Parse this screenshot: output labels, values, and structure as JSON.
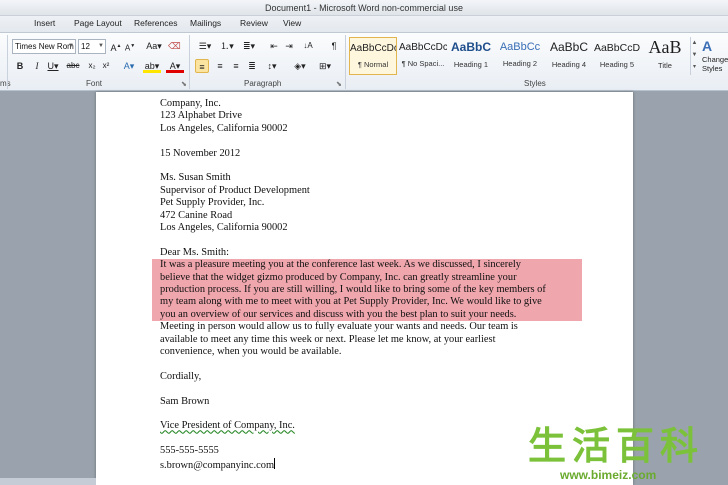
{
  "window": {
    "title": "Document1 - Microsoft Word non-commercial use"
  },
  "menu_tabs": [
    "Insert",
    "Page Layout",
    "References",
    "Mailings",
    "Review",
    "View"
  ],
  "ribbon": {
    "font_name": "Times New Rom",
    "font_size": "12",
    "groups": {
      "font": "Font",
      "paragraph": "Paragraph",
      "styles": "Styles"
    },
    "styles": [
      {
        "preview": "AaBbCcDc",
        "name": "¶ Normal"
      },
      {
        "preview": "AaBbCcDc",
        "name": "¶ No Spaci..."
      },
      {
        "preview": "AaBbC",
        "name": "Heading 1"
      },
      {
        "preview": "AaBbCc",
        "name": "Heading 2"
      },
      {
        "preview": "AaBbC",
        "name": "Heading 4"
      },
      {
        "preview": "AaBbCcD",
        "name": "Heading 5"
      },
      {
        "preview": "AaB",
        "name": "Title"
      }
    ],
    "change_styles": "Change Styles",
    "left_cut": "ms"
  },
  "document": {
    "lines_top": [
      "Company, Inc.",
      "123 Alphabet Drive",
      "Los Angeles, California 90002",
      "",
      "15 November 2012",
      "",
      "Ms. Susan Smith",
      "Supervisor of Product Development",
      "Pet Supply Provider, Inc.",
      "472 Canine Road",
      "Los Angeles, California 90002",
      "",
      "Dear Ms. Smith:"
    ],
    "highlighted": [
      "It was a pleasure meeting you at the conference last week. As we discussed, I sincerely",
      "believe that the widget gizmo produced by Company, Inc. can greatly streamline your",
      "production process. If you are still willing, I would like to bring some of the key members of",
      "my team along with me to meet with you at Pet Supply Provider, Inc. We would like to give",
      "you an overview of our services and discuss with you the best plan to suit your needs."
    ],
    "lines_bottom": [
      "Meeting in person would allow us to fully evaluate your wants and needs. Our team is",
      "available to meet any time this week or next. Please let me know, at your earliest",
      "convenience, when you would be available.",
      "",
      "Cordially,",
      "",
      "Sam Brown",
      ""
    ],
    "signature_title": "Vice President of Company, Inc.",
    "phone": "555-555-5555",
    "email": "s.brown@companyinc.com"
  },
  "watermark": {
    "chars": "生活百科",
    "url": "www.bimeiz.com"
  }
}
